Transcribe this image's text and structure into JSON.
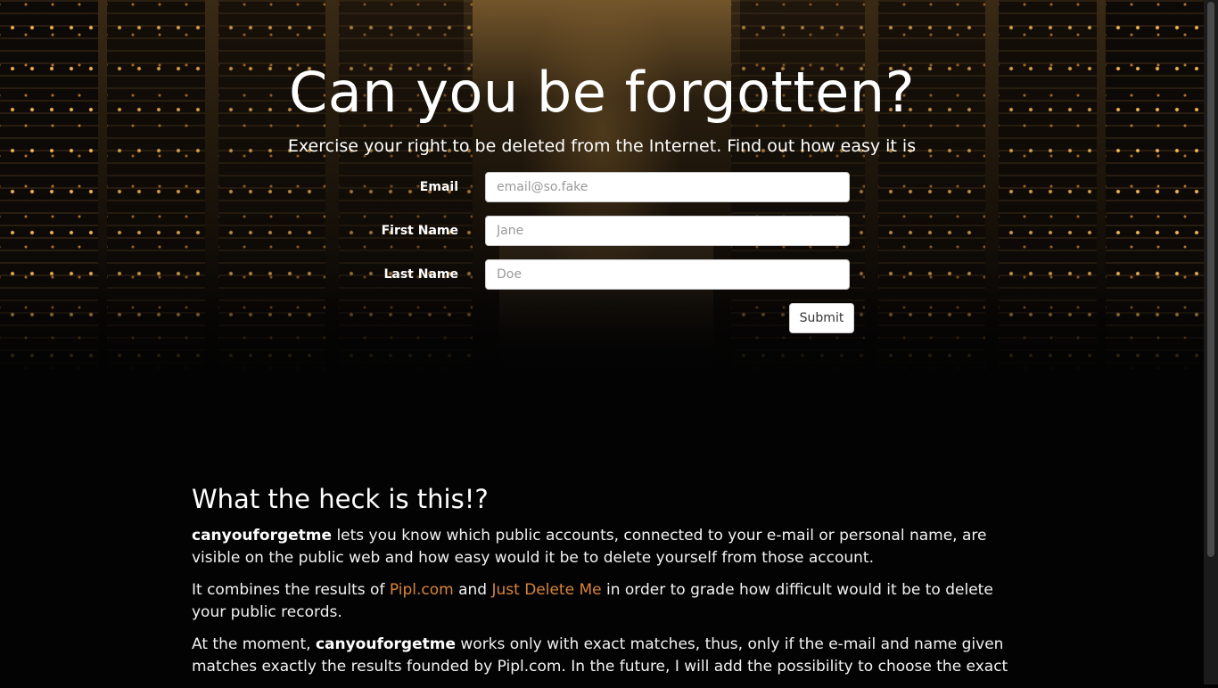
{
  "hero": {
    "title": "Can you be forgotten?",
    "subtitle": "Exercise your right to be deleted from the Internet. Find out how easy it is"
  },
  "form": {
    "email": {
      "label": "Email",
      "placeholder": "email@so.fake",
      "value": ""
    },
    "first_name": {
      "label": "First Name",
      "placeholder": "Jane",
      "value": ""
    },
    "last_name": {
      "label": "Last Name",
      "placeholder": "Doe",
      "value": ""
    },
    "submit_label": "Submit"
  },
  "about": {
    "heading": "What the heck is this!?",
    "p1": {
      "brand": "canyouforgetme",
      "text": " lets you know which public accounts, connected to your e-mail or personal name, are visible on the public web and how easy would it be to delete yourself from those account."
    },
    "p2": {
      "part1": "It combines the results of ",
      "link1": "Pipl.com",
      "part2": " and ",
      "link2": "Just Delete Me",
      "part3": " in order to grade how difficult would it be to delete your public records."
    },
    "p3": {
      "part1": "At the moment, ",
      "brand": "canyouforgetme",
      "part2": " works only with exact matches, thus, only if the e-mail and name given matches exactly the results founded by Pipl.com. In the future, I will add the possibility to choose the exact"
    }
  },
  "colors": {
    "link": "#d9843b",
    "background": "#030303",
    "text": "#ffffff"
  }
}
